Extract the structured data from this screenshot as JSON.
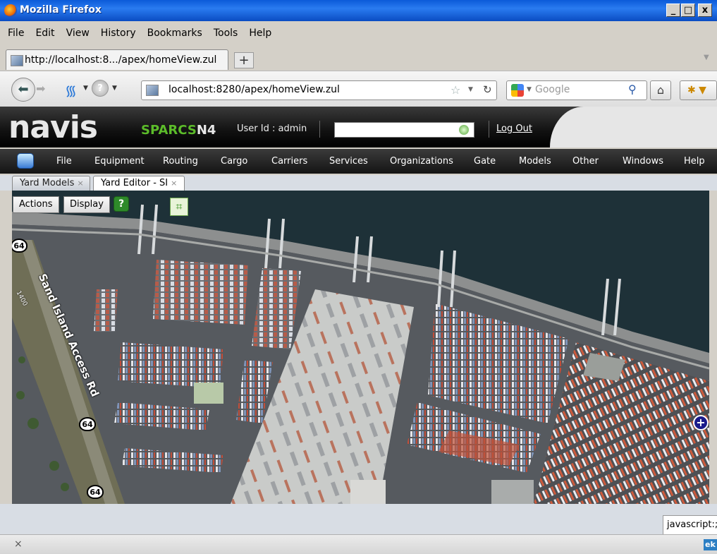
{
  "window": {
    "title": "Mozilla Firefox",
    "controls": [
      "_",
      "□",
      "x"
    ]
  },
  "menubar": {
    "items": [
      "File",
      "Edit",
      "View",
      "History",
      "Bookmarks",
      "Tools",
      "Help"
    ]
  },
  "browser_tab": {
    "label": "http://localhost:8.../apex/homeView.zul",
    "new_tab": "+"
  },
  "navbar": {
    "url": "localhost:8280/apex/homeView.zul",
    "search_placeholder": "Google"
  },
  "app_header": {
    "logo": "navis",
    "brand_prefix": "SPARCS",
    "brand_suffix": "N4",
    "user_text": "User Id : admin",
    "search_value": "",
    "logout": "Log Out"
  },
  "app_menu": {
    "items": [
      "File",
      "Equipment",
      "Routing",
      "Cargo",
      "Carriers",
      "Services",
      "Organizations",
      "Gate",
      "Models",
      "Other",
      "Windows",
      "Help"
    ]
  },
  "app_tabs": [
    {
      "label": "Yard Models",
      "close": "×"
    },
    {
      "label": "Yard Editor - SI",
      "close": "×"
    }
  ],
  "map": {
    "actions_label": "Actions",
    "display_label": "Display",
    "help_label": "?",
    "grid_label": "⌗",
    "zoom_label": "+",
    "road_label": "Sand Island Access Rd",
    "route_shields": [
      "64",
      "64",
      "64"
    ],
    "small_shield": "1400"
  },
  "status": {
    "link": "javascript:;"
  },
  "addon_bar": {
    "close": "×",
    "badge": "ek"
  }
}
